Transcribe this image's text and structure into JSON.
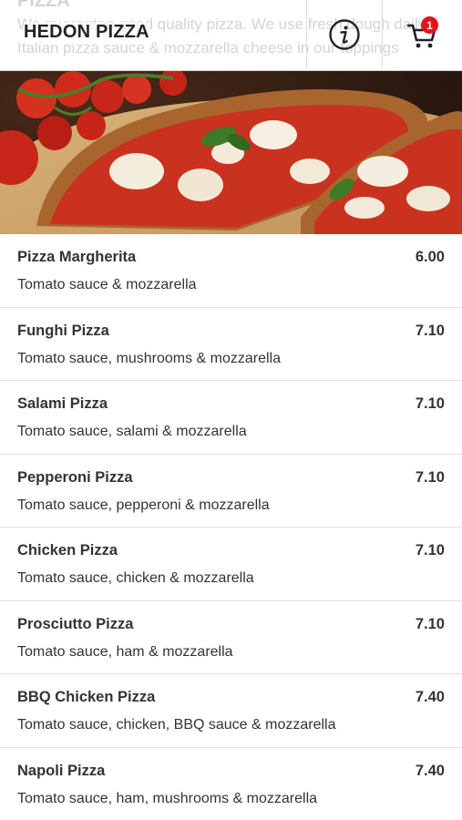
{
  "header": {
    "ghost_title": "PIZZA",
    "ghost_line1": "We guarantee good quality pizza. We use fresh dough daily,",
    "ghost_line2": "Italian pizza sauce & mozzarella cheese in our toppings",
    "brand": "HEDON PIZZA",
    "cart_count": "1",
    "info_icon": "info-circle-icon",
    "cart_icon": "shopping-cart-icon"
  },
  "colors": {
    "badge": "#e3131b",
    "text": "#333333",
    "divider": "#dedede"
  },
  "menu": {
    "items": [
      {
        "name": "Pizza Margherita",
        "price": "6.00",
        "desc": "Tomato sauce & mozzarella"
      },
      {
        "name": "Funghi Pizza",
        "price": "7.10",
        "desc": "Tomato sauce, mushrooms & mozzarella"
      },
      {
        "name": "Salami Pizza",
        "price": "7.10",
        "desc": "Tomato sauce, salami & mozzarella"
      },
      {
        "name": "Pepperoni Pizza",
        "price": "7.10",
        "desc": "Tomato sauce, pepperoni & mozzarella"
      },
      {
        "name": "Chicken Pizza",
        "price": "7.10",
        "desc": "Tomato sauce, chicken & mozzarella"
      },
      {
        "name": "Prosciutto Pizza",
        "price": "7.10",
        "desc": "Tomato sauce, ham & mozzarella"
      },
      {
        "name": "BBQ Chicken Pizza",
        "price": "7.40",
        "desc": "Tomato sauce, chicken, BBQ sauce & mozzarella"
      },
      {
        "name": "Napoli Pizza",
        "price": "7.40",
        "desc": "Tomato sauce, ham, mushrooms & mozzarella"
      }
    ]
  }
}
